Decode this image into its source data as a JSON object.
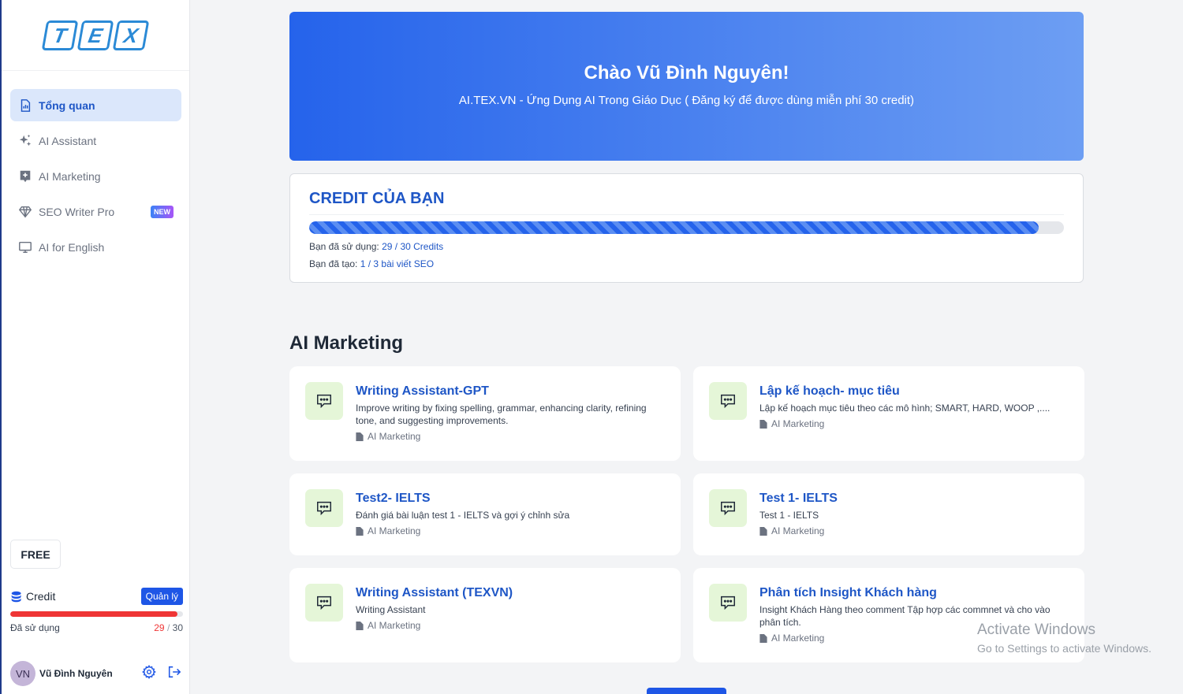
{
  "logo": {
    "letters": [
      "T",
      "E",
      "X"
    ]
  },
  "sidebar": {
    "items": [
      {
        "label": "Tổng quan",
        "icon": "chart-document-icon",
        "active": true
      },
      {
        "label": "AI Assistant",
        "icon": "sparkles-icon"
      },
      {
        "label": "AI Marketing",
        "icon": "ai-plus-icon"
      },
      {
        "label": "SEO Writer Pro",
        "icon": "diamond-icon",
        "badge": "NEW"
      },
      {
        "label": "AI for English",
        "icon": "monitor-icon"
      }
    ],
    "plan": "FREE",
    "credit": {
      "label": "Credit",
      "manage_label": "Quản lý",
      "used_label": "Đã sử dụng",
      "used": "29",
      "separator": "/",
      "total": "30",
      "used_fraction": 0.967
    },
    "user": {
      "initials": "VN",
      "name": "Vũ Đình Nguyên"
    }
  },
  "hero": {
    "title": "Chào Vũ Đình Nguyên!",
    "subtitle": "AI.TEX.VN - Ứng Dụng AI Trong Giáo Dục ( Đăng ký để được dùng miễn phí 30 credit)"
  },
  "credit_card": {
    "title": "CREDIT CỦA BẠN",
    "progress_fraction": 0.967,
    "used_label": "Bạn đã sử dụng:",
    "used_value": "29 / 30 Credits",
    "created_label": "Bạn đã tạo:",
    "created_value": "1 / 3 bài viết SEO"
  },
  "section": {
    "title": "AI Marketing"
  },
  "cards": [
    {
      "title": "Writing Assistant-GPT",
      "desc": "Improve writing by fixing spelling, grammar, enhancing clarity, refining tone, and suggesting improvements.",
      "category": "AI Marketing"
    },
    {
      "title": "Lập kế hoạch- mục tiêu",
      "desc": "Lập kế hoạch mục tiêu theo các mô hình; SMART, HARD, WOOP ,....",
      "category": "AI Marketing"
    },
    {
      "title": "Test2- IELTS",
      "desc": "Đánh giá bài luận test 1 - IELTS và gợi ý chỉnh sửa",
      "category": "AI Marketing"
    },
    {
      "title": "Test 1- IELTS",
      "desc": "Test 1 - IELTS",
      "category": "AI Marketing"
    },
    {
      "title": "Writing Assistant (TEXVN)",
      "desc": "Writing Assistant",
      "category": "AI Marketing"
    },
    {
      "title": "Phân tích Insight Khách hàng",
      "desc": "Insight Khách Hàng theo comment Tập hợp các commnet và cho vào phân tích.",
      "category": "AI Marketing"
    }
  ],
  "watermark": {
    "line1": "Activate Windows",
    "line2": "Go to Settings to activate Windows."
  },
  "colors": {
    "primary": "#1e56e6",
    "credit_bar": "#ef3535",
    "icon_bg": "#e5f6d8"
  }
}
